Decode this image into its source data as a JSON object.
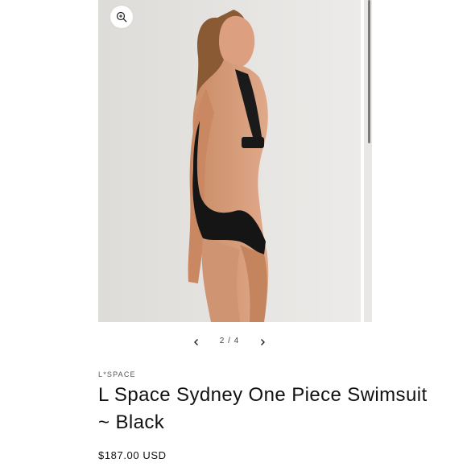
{
  "gallery": {
    "zoom_icon": "magnifier-plus-icon",
    "image_description_icon": "product-photo"
  },
  "slider": {
    "counter": "2 / 4",
    "prev_icon": "chevron-left-icon",
    "next_icon": "chevron-right-icon"
  },
  "product": {
    "vendor": "L*SPACE",
    "title": "L Space Sydney One Piece Swimsuit ~ Black",
    "price": "$187.00 USD"
  },
  "colors": {
    "background": "#ffffff",
    "photo_bg": "#e5e4e2",
    "text": "#121212",
    "swimsuit": "#151515"
  }
}
